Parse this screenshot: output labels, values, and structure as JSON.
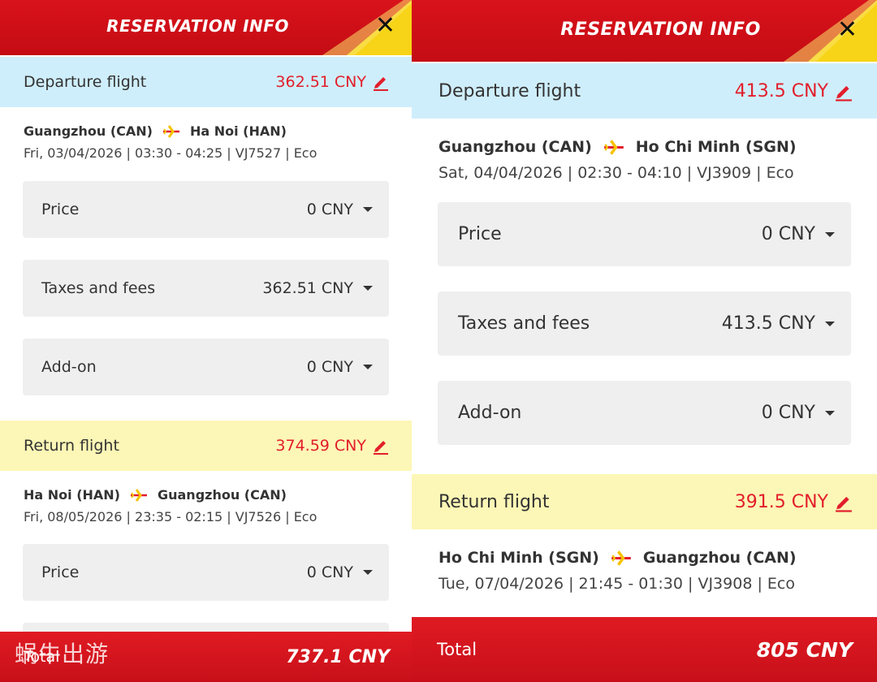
{
  "colors": {
    "header_red": "#d9121b",
    "accent_yellow": "#f7d417",
    "price_red": "#e21e2b",
    "departure_bg": "#cfeefb",
    "return_bg": "#fcf7b6",
    "row_bg": "#efefef"
  },
  "icons": {
    "close": "close-icon",
    "edit": "pencil-icon",
    "plane": "airplane-icon",
    "expand": "caret-down-icon"
  },
  "left": {
    "header": {
      "title": "RESERVATION INFO",
      "close": "✕"
    },
    "departure": {
      "label": "Departure flight",
      "amount": "362.51 CNY",
      "origin": "Guangzhou (CAN)",
      "destination": "Ha Noi (HAN)",
      "details": "Fri, 03/04/2026 | 03:30 - 04:25 | VJ7527 | Eco",
      "fares": [
        {
          "label": "Price",
          "value": "0 CNY"
        },
        {
          "label": "Taxes and fees",
          "value": "362.51 CNY"
        },
        {
          "label": "Add-on",
          "value": "0 CNY"
        }
      ]
    },
    "return": {
      "label": "Return flight",
      "amount": "374.59 CNY",
      "origin": "Ha Noi (HAN)",
      "destination": "Guangzhou (CAN)",
      "details": "Fri, 08/05/2026 | 23:35 - 02:15 | VJ7526 | Eco",
      "fares": [
        {
          "label": "Price",
          "value": "0 CNY"
        }
      ]
    },
    "total": {
      "label": "Total",
      "value": "737.1 CNY"
    },
    "watermark": "蜗牛出游"
  },
  "right": {
    "header": {
      "title": "RESERVATION INFO",
      "close": "✕"
    },
    "departure": {
      "label": "Departure flight",
      "amount": "413.5 CNY",
      "origin": "Guangzhou (CAN)",
      "destination": "Ho Chi Minh (SGN)",
      "details": "Sat, 04/04/2026 | 02:30 - 04:10 | VJ3909 | Eco",
      "fares": [
        {
          "label": "Price",
          "value": "0 CNY"
        },
        {
          "label": "Taxes and fees",
          "value": "413.5 CNY"
        },
        {
          "label": "Add-on",
          "value": "0 CNY"
        }
      ]
    },
    "return": {
      "label": "Return flight",
      "amount": "391.5 CNY",
      "origin": "Ho Chi Minh (SGN)",
      "destination": "Guangzhou (CAN)",
      "details": "Tue, 07/04/2026 | 21:45 - 01:30 | VJ3908 | Eco"
    },
    "total": {
      "label": "Total",
      "value": "805 CNY"
    }
  }
}
